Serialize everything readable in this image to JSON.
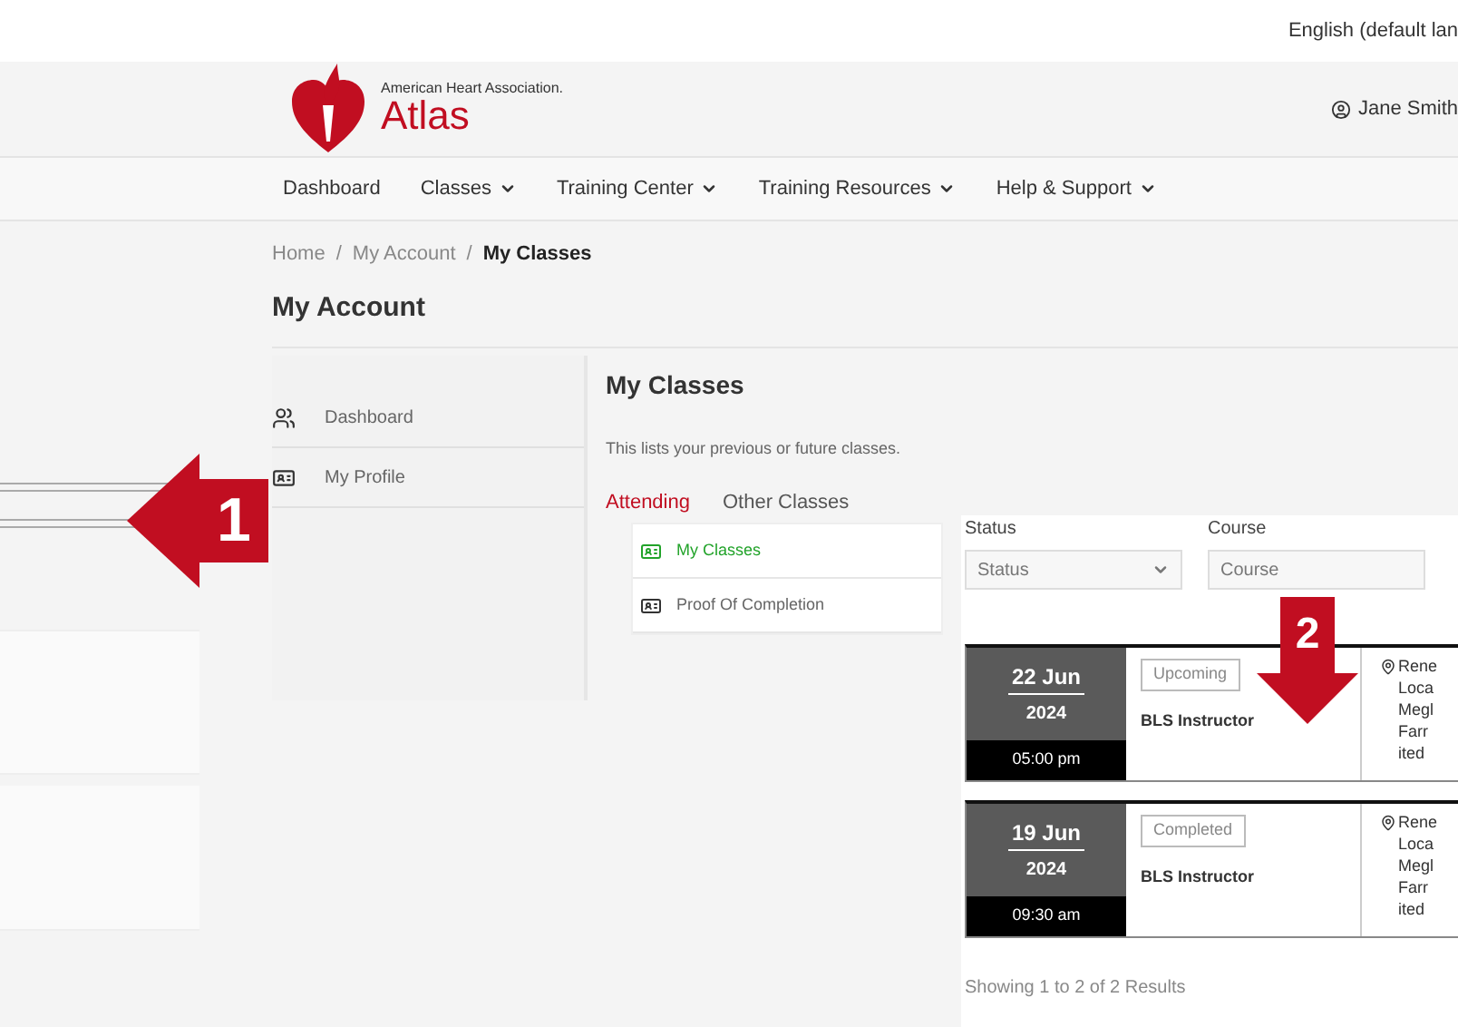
{
  "top_bar": {
    "language": "English (default lan"
  },
  "header": {
    "org": "American Heart Association.",
    "product": "Atlas",
    "user": "Jane Smith"
  },
  "nav": [
    {
      "label": "Dashboard",
      "dropdown": false
    },
    {
      "label": "Classes",
      "dropdown": true
    },
    {
      "label": "Training Center",
      "dropdown": true
    },
    {
      "label": "Training Resources",
      "dropdown": true
    },
    {
      "label": "Help & Support",
      "dropdown": true
    }
  ],
  "breadcrumb": {
    "separator": "/",
    "items": [
      {
        "label": "Home",
        "current": false
      },
      {
        "label": "My Account",
        "current": false
      },
      {
        "label": "My Classes",
        "current": true
      }
    ]
  },
  "page_title": "My Account",
  "sidebar": {
    "items": [
      {
        "label": "Dashboard",
        "selected": false
      },
      {
        "label": "My Profile",
        "selected": false
      }
    ]
  },
  "content": {
    "title": "My Classes",
    "description": "This lists your previous or future classes.",
    "tabs": [
      {
        "label": "Attending",
        "selected": true
      },
      {
        "label": "Other Classes",
        "selected": false
      }
    ]
  },
  "sub_menu": [
    {
      "label": "My Classes",
      "selected": true
    },
    {
      "label": "Proof Of Completion",
      "selected": false
    }
  ],
  "filters": [
    {
      "label": "Status",
      "placeholder": "Status",
      "dropdown": true
    },
    {
      "label": "Course",
      "placeholder": "Course",
      "dropdown": false
    }
  ],
  "classes": [
    {
      "day": "22 Jun",
      "year": "2024",
      "time": "05:00 pm",
      "status": "Upcoming",
      "course": "BLS Instructor",
      "location": [
        "Rene",
        "Loca",
        "Megl",
        "Farr",
        "ited"
      ]
    },
    {
      "day": "19 Jun",
      "year": "2024",
      "time": "09:30 am",
      "status": "Completed",
      "course": "BLS Instructor",
      "location": [
        "Rene",
        "Loca",
        "Megl",
        "Farr",
        "ited"
      ]
    }
  ],
  "results": "Showing 1 to 2 of 2 Results",
  "annotations": [
    {
      "label": "1"
    },
    {
      "label": "2"
    }
  ]
}
